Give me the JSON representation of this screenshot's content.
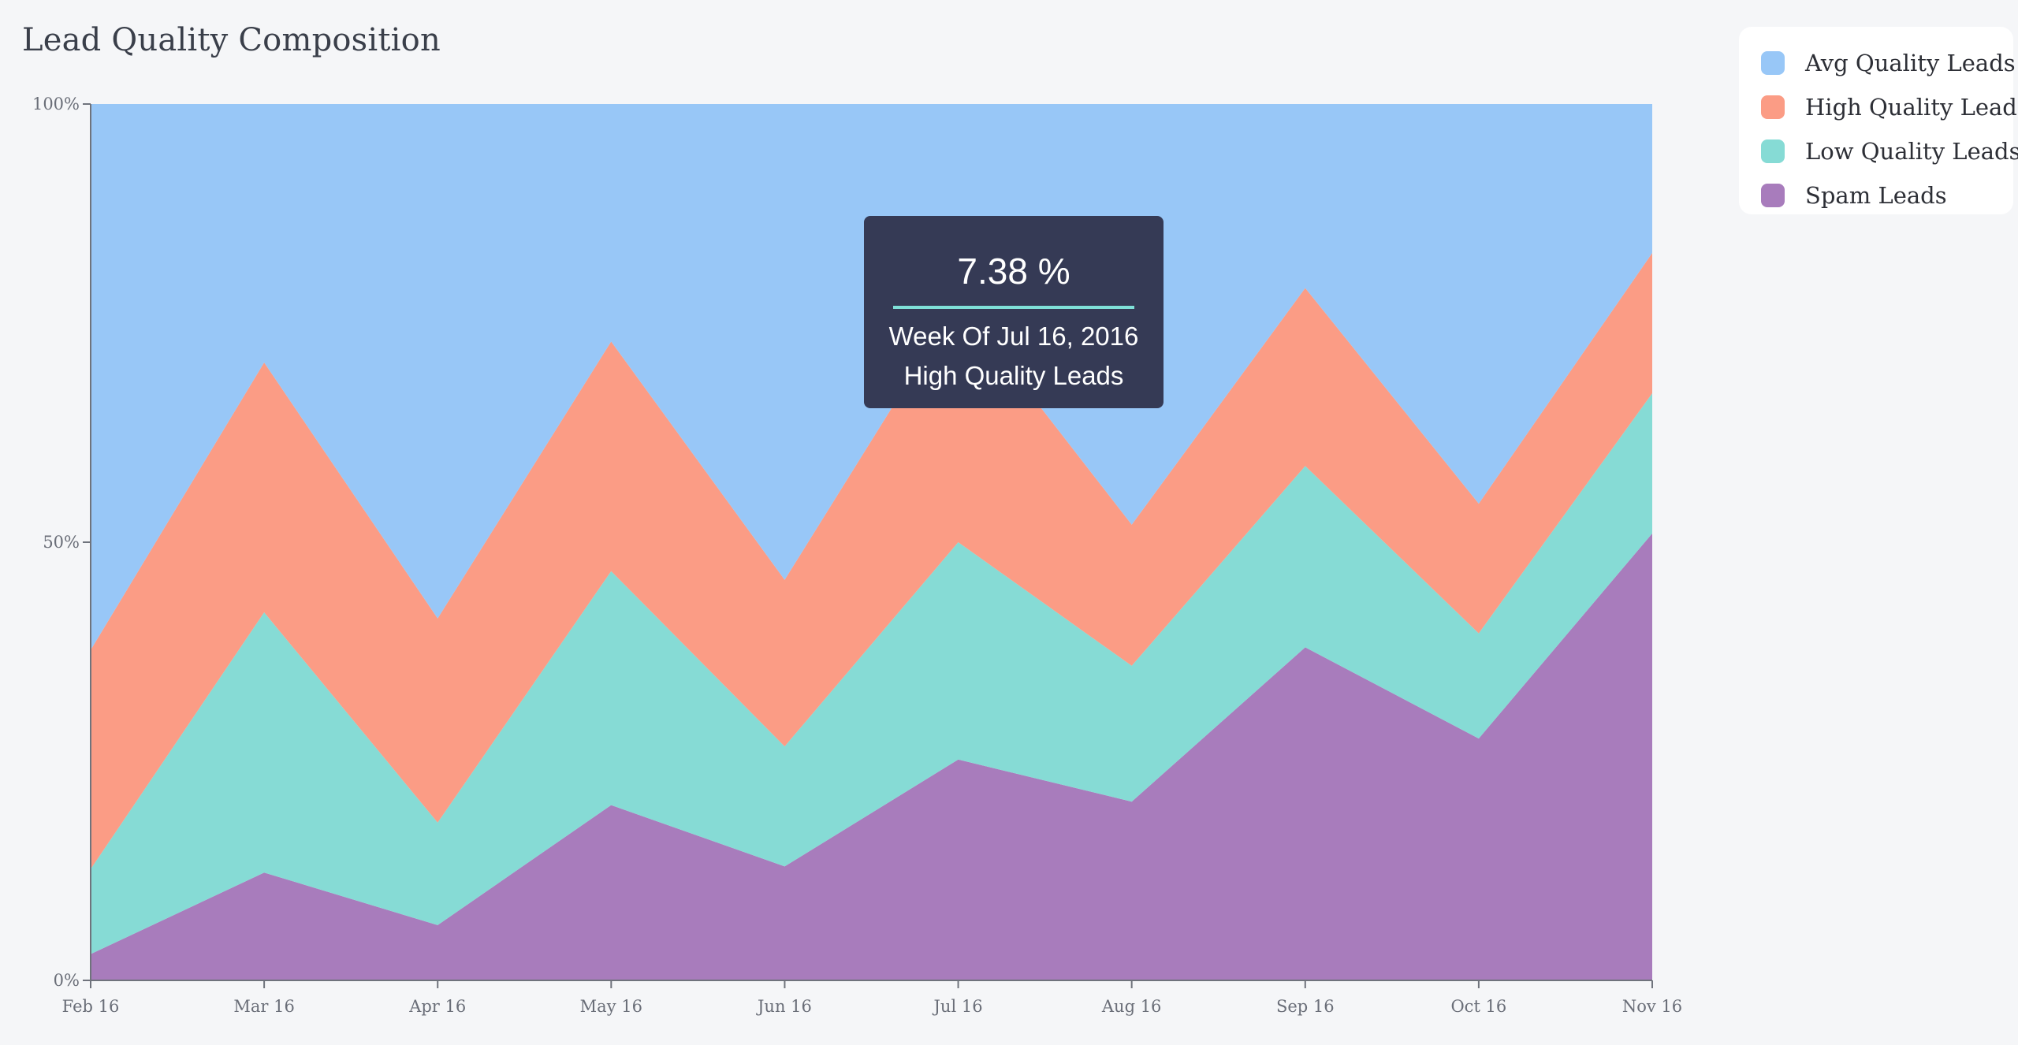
{
  "chart_data": {
    "type": "area",
    "stacked": true,
    "normalized": true,
    "title": "Lead Quality Composition",
    "x": [
      "Feb 16",
      "Mar 16",
      "Apr 16",
      "May 16",
      "Jun 16",
      "Jul 16",
      "Aug 16",
      "Sep 16",
      "Oct 16",
      "Nov 16"
    ],
    "y_ticks": [
      "0%",
      "50%",
      "100%"
    ],
    "ylim": [
      0,
      100
    ],
    "series": [
      {
        "name": "Spam Leads",
        "color": "#a87cbc",
        "values": [
          3,
          12.3,
          6.3,
          20,
          13,
          25.2,
          20.4,
          38,
          27.6,
          51
        ]
      },
      {
        "name": "Low Quality Leads",
        "color": "#86dbd5",
        "values": [
          9.7,
          29.7,
          11.7,
          26.7,
          13.7,
          24.8,
          15.5,
          20.7,
          12,
          16
        ]
      },
      {
        "name": "High Quality Leads",
        "color": "#fb9c85",
        "values": [
          25,
          28.5,
          23.3,
          26.2,
          19,
          27.5,
          16.1,
          20.3,
          14.8,
          16
        ]
      },
      {
        "name": "Avg Quality Leads",
        "color": "#98c7f7",
        "values": [
          62.3,
          29.5,
          58.7,
          27.1,
          54.3,
          22.5,
          48,
          21,
          45.6,
          17
        ]
      }
    ],
    "legend": {
      "position": "top-right",
      "items": [
        {
          "label": "Avg Quality Leads",
          "color": "#98c7f7"
        },
        {
          "label": "High Quality Leads",
          "color": "#fb9c85"
        },
        {
          "label": "Low Quality Leads",
          "color": "#86dbd5"
        },
        {
          "label": "Spam Leads",
          "color": "#a87cbc"
        }
      ]
    },
    "tooltip": {
      "value": "7.38 %",
      "date": "Week Of Jul 16, 2016",
      "series": "High Quality Leads"
    }
  }
}
